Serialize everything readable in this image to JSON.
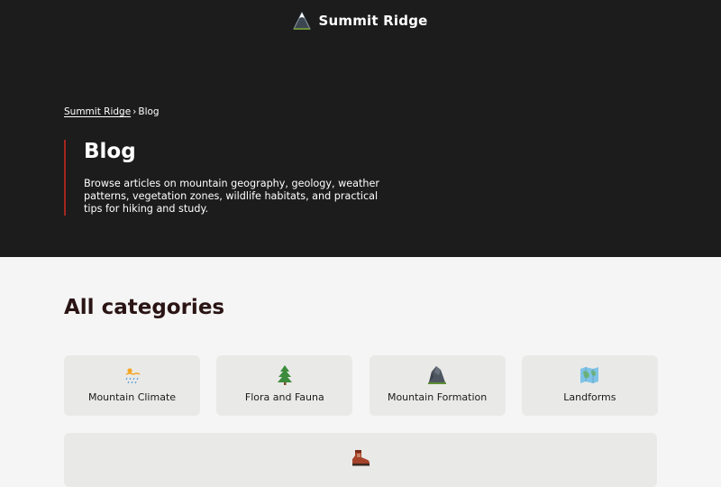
{
  "header": {
    "brand_name": "Summit Ridge",
    "logo_icon": "mountain-logo-icon"
  },
  "breadcrumb": {
    "home": "Summit Ridge",
    "separator": "›",
    "current": "Blog"
  },
  "intro": {
    "title": "Blog",
    "description": "Browse articles on mountain geography, geology, weather patterns, vegetation zones, wildlife habitats, and practical tips for hiking and study."
  },
  "categories": {
    "title": "All categories",
    "items": [
      {
        "label": "Mountain Climate",
        "icon": "weather-icon"
      },
      {
        "label": "Flora and Fauna",
        "icon": "tree-icon"
      },
      {
        "label": "Mountain Formation",
        "icon": "rock-icon"
      },
      {
        "label": "Landforms",
        "icon": "map-icon"
      },
      {
        "label": "",
        "icon": "hiking-boot-icon"
      }
    ]
  },
  "colors": {
    "hero_background": "#1c1c1d",
    "accent": "#a3261d",
    "section_title": "#2a1414",
    "card_background": "#e9e9e7"
  }
}
